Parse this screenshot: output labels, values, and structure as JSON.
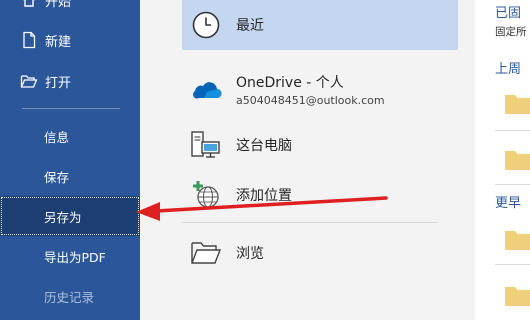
{
  "sidebar": {
    "top_items": [
      {
        "label": "开始",
        "icon": "home-icon"
      },
      {
        "label": "新建",
        "icon": "new-document-icon"
      },
      {
        "label": "打开",
        "icon": "open-folder-icon"
      }
    ],
    "sub_items": [
      {
        "label": "信息"
      },
      {
        "label": "保存"
      },
      {
        "label": "另存为",
        "active": true
      },
      {
        "label": "导出为PDF"
      },
      {
        "label": "历史记录"
      }
    ],
    "bg_color": "#2b579a",
    "active_color": "#1d3f73"
  },
  "locations": [
    {
      "label": "最近",
      "icon": "clock-icon",
      "selected": true
    },
    {
      "label": "OneDrive - 个人",
      "sublabel": "a504048451@outlook.com",
      "icon": "onedrive-cloud-icon"
    },
    {
      "label": "这台电脑",
      "icon": "computer-icon"
    },
    {
      "label": "添加位置",
      "icon": "add-location-globe-icon"
    },
    {
      "label": "浏览",
      "icon": "browse-folder-icon"
    }
  ],
  "right_panel": {
    "pinned_heading": "已固",
    "pinned_desc": "固定所",
    "last_week_heading": "上周",
    "earlier_heading": "更早",
    "folder_color": "#f0cf7c"
  },
  "annotation": {
    "arrow_color": "#e02020"
  }
}
